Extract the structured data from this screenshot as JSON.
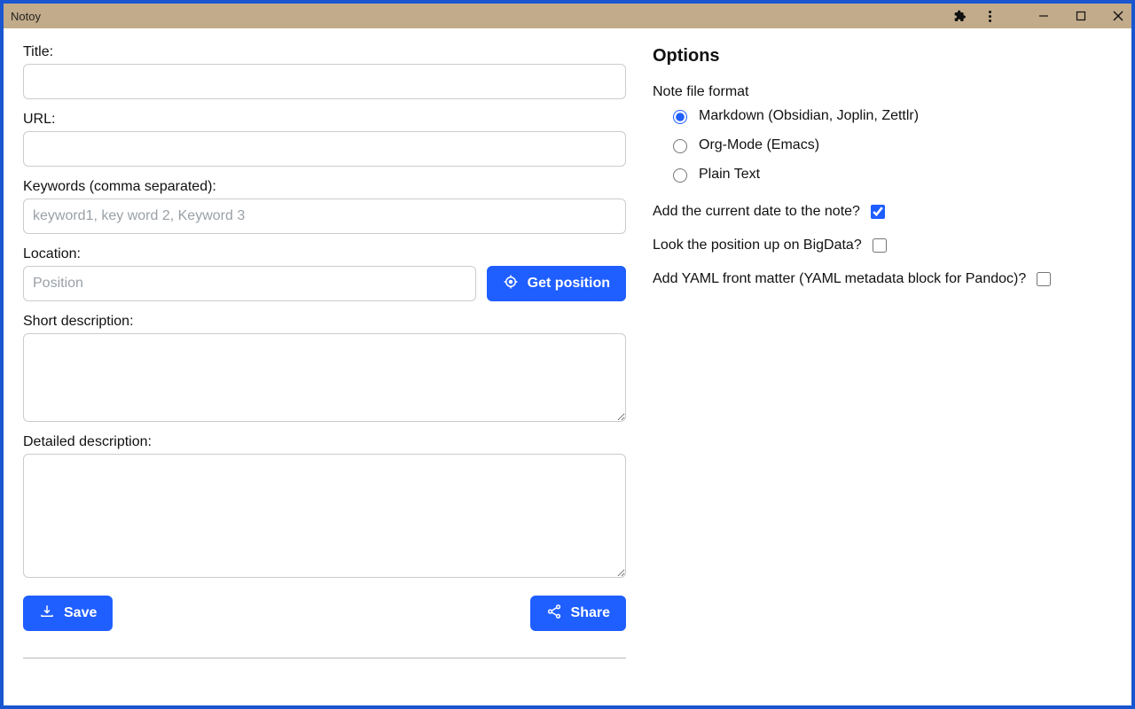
{
  "window": {
    "title": "Notoy"
  },
  "form": {
    "title_label": "Title:",
    "url_label": "URL:",
    "keywords_label": "Keywords (comma separated):",
    "keywords_placeholder": "keyword1, key word 2, Keyword 3",
    "location_label": "Location:",
    "location_placeholder": "Position",
    "get_position_label": "Get position",
    "short_desc_label": "Short description:",
    "detailed_desc_label": "Detailed description:",
    "save_label": "Save",
    "share_label": "Share"
  },
  "options": {
    "heading": "Options",
    "format_label": "Note file format",
    "formats": {
      "markdown": "Markdown (Obsidian, Joplin, Zettlr)",
      "orgmode": "Org-Mode (Emacs)",
      "plaintext": "Plain Text"
    },
    "selected_format": "markdown",
    "add_date_label": "Add the current date to the note?",
    "add_date_checked": true,
    "bigdata_label": "Look the position up on BigData?",
    "bigdata_checked": false,
    "yaml_label": "Add YAML front matter (YAML metadata block for Pandoc)?",
    "yaml_checked": false
  }
}
